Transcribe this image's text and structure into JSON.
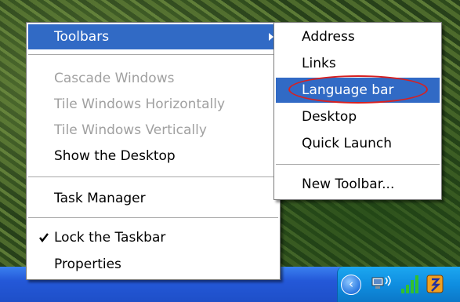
{
  "context_menu": {
    "toolbars_label": "Toolbars",
    "cascade_label": "Cascade Windows",
    "tile_h_label": "Tile Windows Horizontally",
    "tile_v_label": "Tile Windows Vertically",
    "show_desktop_label": "Show the Desktop",
    "task_manager_label": "Task Manager",
    "lock_taskbar_label": "Lock the Taskbar",
    "lock_taskbar_checked": true,
    "properties_label": "Properties"
  },
  "toolbars_submenu": {
    "items": [
      {
        "label": "Address"
      },
      {
        "label": "Links"
      },
      {
        "label": "Language bar",
        "highlighted": true
      },
      {
        "label": "Desktop"
      },
      {
        "label": "Quick Launch"
      }
    ],
    "new_toolbar_label": "New Toolbar..."
  },
  "colors": {
    "menu_highlight": "#316ac5",
    "annotation_circle": "#d82020",
    "taskbar": "#2458d8",
    "tray": "#0f8ee0"
  },
  "icons": {
    "check": "check-icon",
    "submenu_arrow": "chevron-right-icon",
    "tray": [
      "tray-expand-icon",
      "network-icon",
      "signal-strength-icon",
      "app-icon"
    ]
  }
}
